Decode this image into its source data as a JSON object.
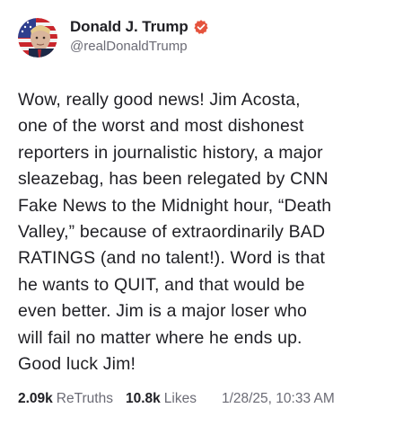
{
  "author": {
    "display_name": "Donald J. Trump",
    "handle": "@realDonaldTrump",
    "verified_badge_icon": "verified-badge-icon",
    "badge_color": "#e5533d"
  },
  "post": {
    "lines": [
      "Wow, really good news! Jim Acosta,",
      "one of the worst and most dishonest",
      "reporters in journalistic history, a major",
      "sleazebag, has been relegated by CNN",
      "Fake News to the Midnight hour, “Death",
      "Valley,” because of extraordinarily BAD",
      "RATINGS (and no talent!). Word is that",
      "he wants to QUIT, and that would be",
      "even better. Jim is a major loser who",
      "will fail no matter where he ends up.",
      "Good luck Jim!"
    ]
  },
  "stats": {
    "retruths_count": "2.09k",
    "retruths_label": "ReTruths",
    "likes_count": "10.8k",
    "likes_label": "Likes",
    "timestamp": "1/28/25, 10:33 AM"
  },
  "colors": {
    "text_primary": "#1f1f24",
    "text_secondary": "#6b6b75",
    "background": "#ffffff"
  }
}
